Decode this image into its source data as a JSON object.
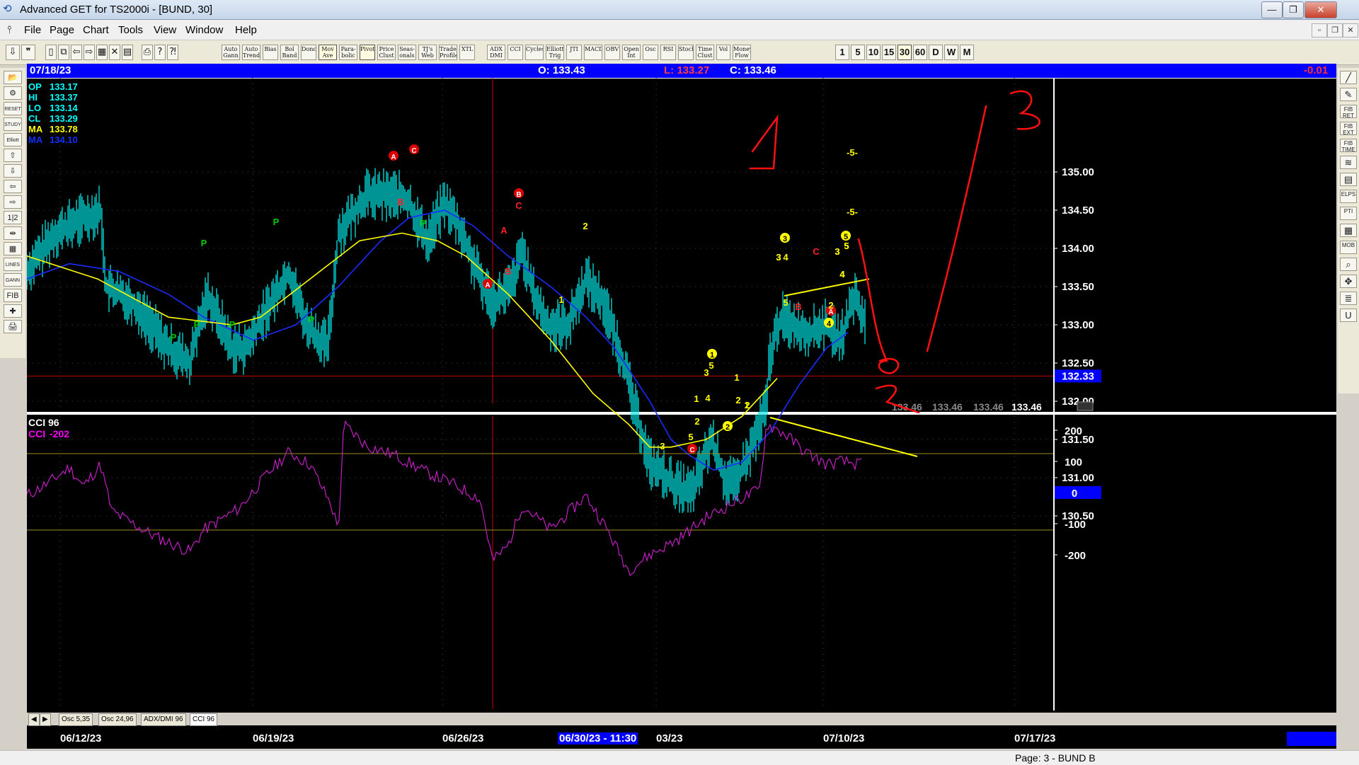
{
  "window": {
    "title": "Advanced GET for TS2000i - [BUND, 30]",
    "minimize": "—",
    "maximize": "❐",
    "close": "✕",
    "mdi_minimize": "▫",
    "mdi_restore": "❐",
    "mdi_close": "✕"
  },
  "menu": [
    "File",
    "Page",
    "Chart",
    "Tools",
    "View",
    "Window",
    "Help"
  ],
  "toolbar": {
    "studies": [
      "Auto Gann",
      "Auto Trend",
      "Bias",
      "Bol Band",
      "Donch",
      "Mov Ave",
      "Para- bolic",
      "Pivot",
      "Price Clust",
      "Seas- onals",
      "TJ's Web",
      "Trade Profile",
      "XTL",
      "ADX DMI",
      "CCI",
      "Cycles",
      "Elliott Trig",
      "JTI",
      "MACD",
      "OBV",
      "Open Int",
      "Osc",
      "RSI",
      "Stoch",
      "Time Clust",
      "Vol",
      "Money Flow"
    ],
    "periods": [
      "1",
      "5",
      "10",
      "15",
      "30",
      "60",
      "D",
      "W",
      "M"
    ],
    "active_period": "30"
  },
  "left_tools": [
    "📂",
    "⚙",
    "RESET",
    "STUDY",
    "Elliott",
    "⇧",
    "⇩",
    "⇦",
    "⇨",
    "1|2",
    "⇹",
    "▦",
    "LINES",
    "GANN",
    "FIB",
    "✚",
    "🖨"
  ],
  "right_tools": [
    "╱",
    "✎",
    "FIB RET",
    "FIB EXT",
    "FIB TIME",
    "≋",
    "▤",
    "ELPS",
    "PTI",
    "▦",
    "MOB",
    "⌕",
    "✥",
    "≣",
    "U"
  ],
  "info": {
    "date": "07/18/23",
    "open": "O: 133.43",
    "low": "L: 133.27",
    "close": "C: 133.46",
    "change": "-0.01"
  },
  "legend": [
    {
      "label": "OP",
      "value": "133.17",
      "color": "#00ffff"
    },
    {
      "label": "HI",
      "value": "133.37",
      "color": "#00ffff"
    },
    {
      "label": "LO",
      "value": "133.14",
      "color": "#00ffff"
    },
    {
      "label": "CL",
      "value": "133.29",
      "color": "#00ffff"
    },
    {
      "label": "MA",
      "value": "133.78",
      "color": "#ffff00"
    },
    {
      "label": "MA",
      "value": "134.10",
      "color": "#1030ff"
    }
  ],
  "price_axis": [
    "135.00",
    "134.50",
    "134.00",
    "133.50",
    "133.00",
    "132.50",
    "132.00",
    "131.50",
    "131.00",
    "130.50"
  ],
  "crosshair_price": "132.33",
  "last_prices": [
    "133.46",
    "133.46",
    "133.46",
    "133.46"
  ],
  "cci": {
    "title": "CCI 96",
    "label": "CCI",
    "value": "-202",
    "axis": [
      "200",
      "100",
      "0",
      "-100",
      "-200"
    ]
  },
  "tabs": [
    "Osc 5,35",
    "Osc 24,96",
    "ADX/DMI 96",
    "CCI 96"
  ],
  "active_tab": "CCI 96",
  "dates": [
    "06/12/23",
    "06/19/23",
    "06/26/23",
    "03/23",
    "07/10/23",
    "07/17/23"
  ],
  "cursor_date": "06/30/23 - 11:30",
  "status": "Page: 3 - BUND B",
  "wave_labels": {
    "green": [
      "P",
      "P",
      "P",
      "P",
      "P",
      "P",
      "P"
    ],
    "red": [
      "A",
      "C",
      "B",
      "B",
      "C",
      "A",
      "B",
      "A",
      "C",
      "B",
      "A",
      "C"
    ],
    "yellow": [
      "-5-",
      "-5-",
      "2",
      "1",
      "3",
      "5",
      "3",
      "4",
      "5",
      "3",
      "1",
      "4",
      "2",
      "1",
      "2",
      "3",
      "5",
      "5",
      "3",
      "4",
      "4",
      "2",
      "1",
      "2",
      "3",
      "5",
      "4"
    ],
    "circled_yellow": [
      "1",
      "2",
      "3",
      "5",
      "4"
    ]
  },
  "chart_data": {
    "type": "line",
    "title": "",
    "price": {
      "x": [
        "06/12/23",
        "06/14/23",
        "06/16/23",
        "06/19/23",
        "06/21/23",
        "06/23/23",
        "06/26/23",
        "06/28/23",
        "06/30/23",
        "07/03/23",
        "07/05/23",
        "07/07/23",
        "07/10/23",
        "07/12/23",
        "07/14/23",
        "07/17/23",
        "07/18/23"
      ],
      "values": [
        133.8,
        134.3,
        132.8,
        133.3,
        132.9,
        133.6,
        134.7,
        134.5,
        133.4,
        133.0,
        133.4,
        132.2,
        130.7,
        131.3,
        133.0,
        133.1,
        133.46
      ],
      "ylim": [
        130.0,
        135.5
      ]
    },
    "cci": {
      "ylim": [
        -250,
        250
      ],
      "overbought": 125,
      "oversold": -125
    }
  }
}
